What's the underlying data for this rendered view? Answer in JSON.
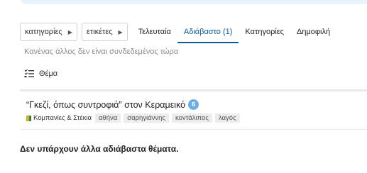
{
  "nav": {
    "categories_dropdown": "κατηγορίες",
    "tags_dropdown": "ετικέτες",
    "links": [
      {
        "label": "Τελευταία",
        "active": false
      },
      {
        "label": "Αδιάβαστο (1)",
        "active": true
      },
      {
        "label": "Κατηγορίες",
        "active": false
      },
      {
        "label": "Δημοφιλή",
        "active": false
      }
    ]
  },
  "presence": "Κανένας άλλος δεν είναι συνδεδεμένος τώρα",
  "table_header": {
    "topic_label": "Θέμα",
    "icon": "sort-list-icon"
  },
  "topic": {
    "title": "“Γκεζί, όπως συντροφιά” στον Κεραμεικό",
    "unread_count": "6",
    "category": {
      "name": "Κομπανίες & Στέκια",
      "colors": [
        "#e4a52d",
        "#2b8a3e"
      ]
    },
    "tags": [
      "αθήνα",
      "σαρηγιάννης",
      "κοντάλιπος",
      "λαγός"
    ]
  },
  "footer_message": "Δεν υπάρχουν άλλα αδιάβαστα θέματα.",
  "colors": {
    "accent": "#0b5a99",
    "badge": "#6baee6"
  }
}
